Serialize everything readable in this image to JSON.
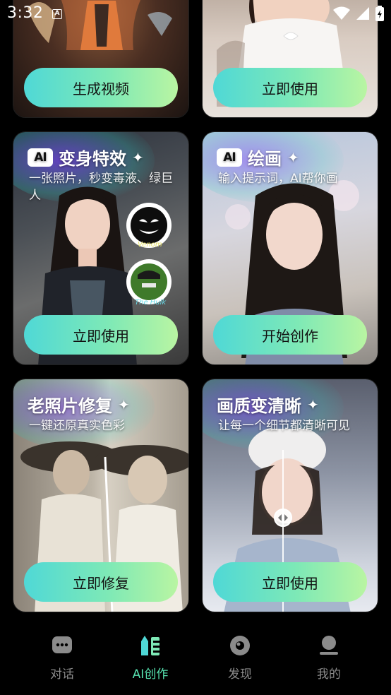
{
  "status_bar": {
    "time": "3:32",
    "notification_badge": "A"
  },
  "cards": [
    {
      "id": "video",
      "button": "生成视频"
    },
    {
      "id": "baby",
      "button": "立即使用"
    },
    {
      "id": "transform",
      "title": "变身特效",
      "subtitle": "一张照片，秒变毒液、绿巨人",
      "button": "立即使用",
      "stickers": [
        "Venom",
        "The Hulk"
      ]
    },
    {
      "id": "painting",
      "title": "绘画",
      "subtitle": "输入提示词，AI帮你画",
      "button": "开始创作"
    },
    {
      "id": "restore",
      "title": "老照片修复",
      "subtitle": "一键还原真实色彩",
      "button": "立即修复"
    },
    {
      "id": "enhance",
      "title": "画质变清晰",
      "subtitle": "让每一个细节都清晰可见",
      "button": "立即使用"
    }
  ],
  "ai_badge": "AI",
  "tabs": [
    {
      "label": "对话",
      "icon": "chat-icon",
      "active": false
    },
    {
      "label": "AI创作",
      "icon": "ai-create-icon",
      "active": true
    },
    {
      "label": "发现",
      "icon": "discover-icon",
      "active": false
    },
    {
      "label": "我的",
      "icon": "profile-icon",
      "active": false
    }
  ],
  "colors": {
    "accent": "#57e2b0",
    "button_gradient_start": "#4fd8d6",
    "button_gradient_end": "#b9f5a2",
    "background": "#000000"
  }
}
